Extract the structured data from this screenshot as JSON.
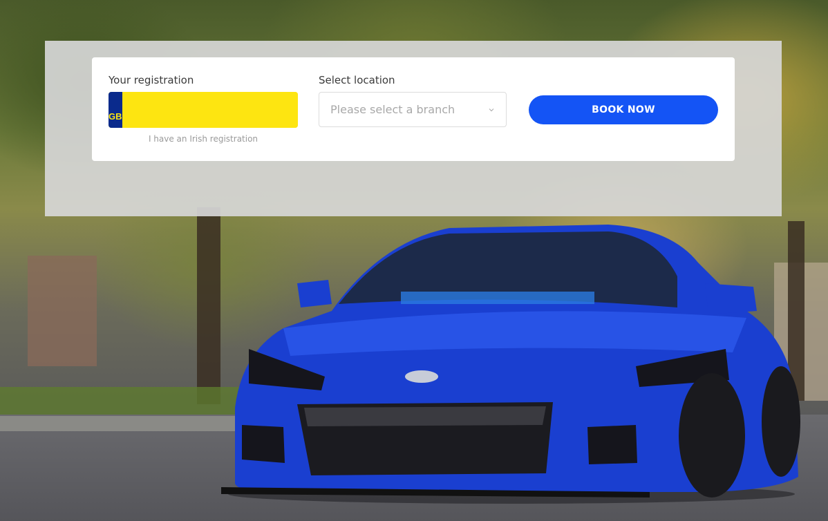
{
  "booking": {
    "registration_label": "Your registration",
    "plate_country": "GB",
    "plate_value": "",
    "irish_link": "I have an Irish registration",
    "location_label": "Select location",
    "location_placeholder": "Please select a branch",
    "book_button": "BOOK NOW"
  },
  "colors": {
    "button_blue": "#1454f5",
    "plate_yellow": "#fde511",
    "plate_blue": "#0a2a8c",
    "car_blue": "#1a3fd0"
  },
  "icons": {
    "select_chevron": "chevron-down-icon"
  }
}
